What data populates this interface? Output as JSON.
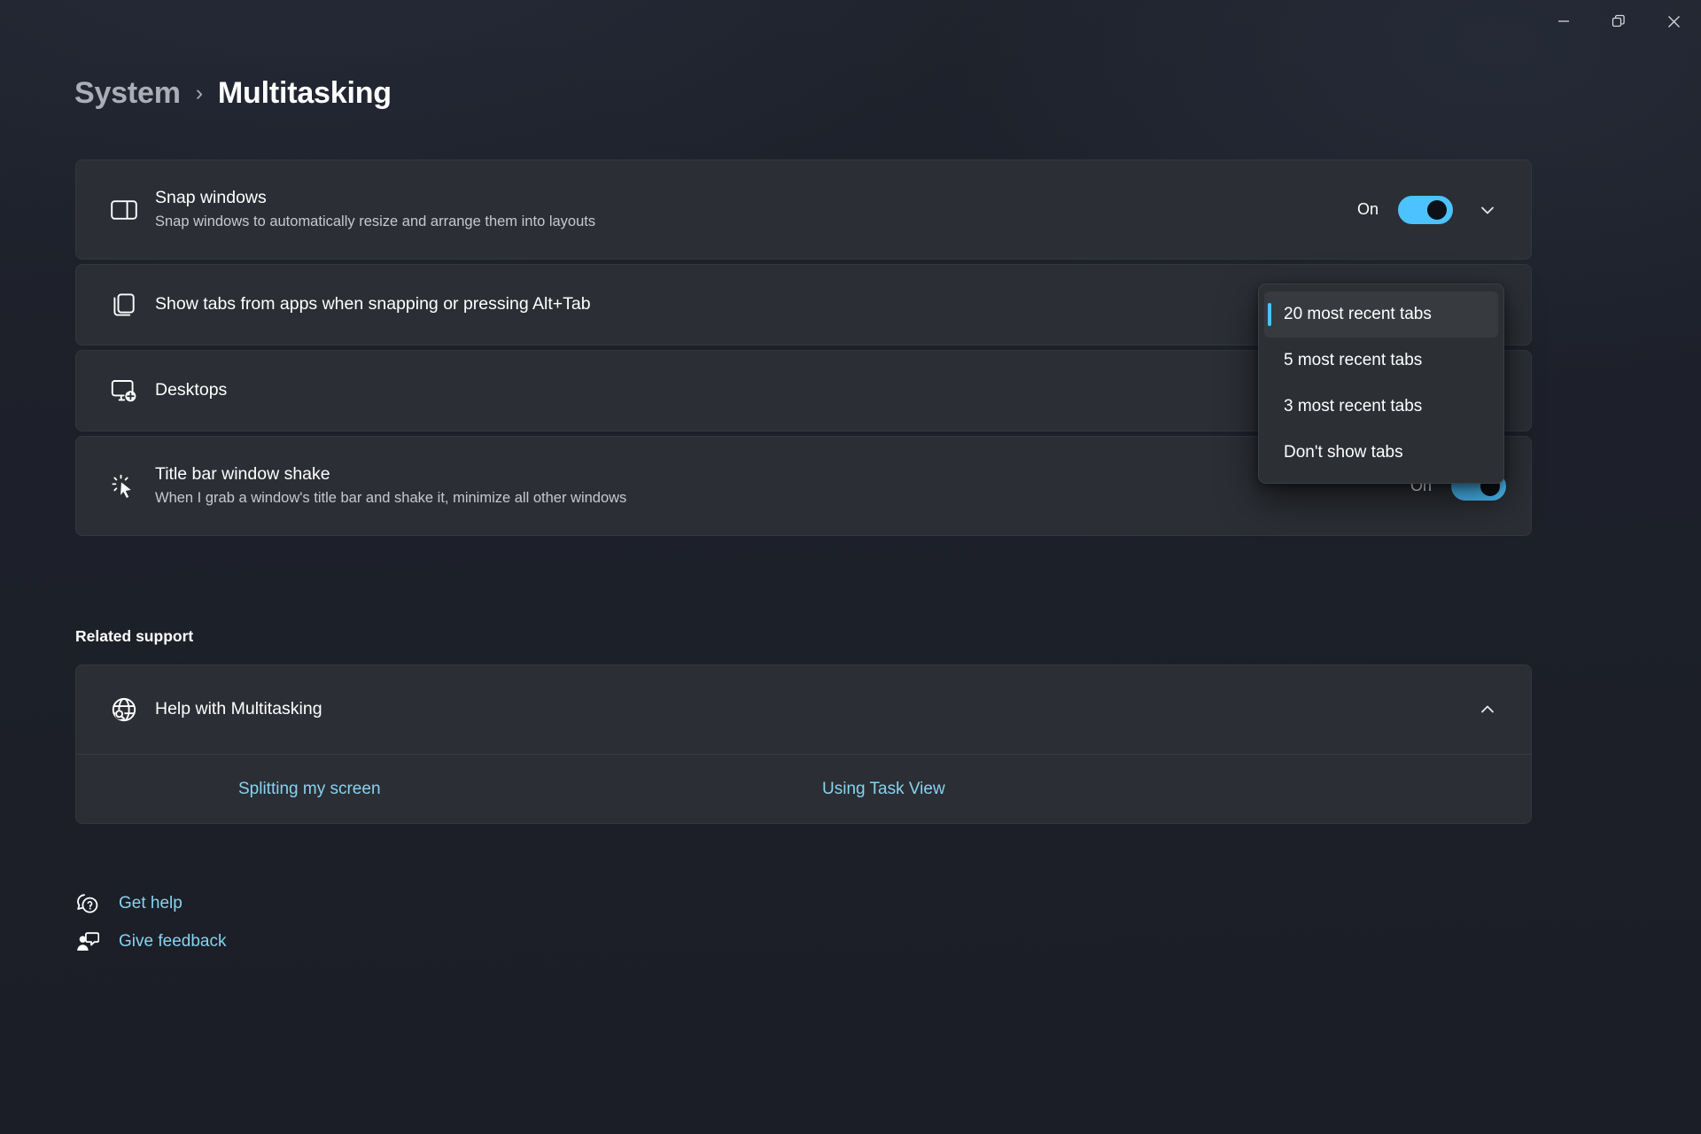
{
  "window": {
    "controls": [
      {
        "name": "minimize-button",
        "glyph": "minimize"
      },
      {
        "name": "restore-button",
        "glyph": "restore"
      },
      {
        "name": "close-button",
        "glyph": "close"
      }
    ]
  },
  "breadcrumb": {
    "parent": "System",
    "separator": "›",
    "current": "Multitasking"
  },
  "settings": [
    {
      "icon": "snap-layout-icon",
      "title": "Snap windows",
      "subtitle": "Snap windows to automatically resize and arrange them into layouts",
      "state_label": "On",
      "toggle": true,
      "expander": "chevron-down-icon"
    },
    {
      "icon": "stacked-windows-icon",
      "title": "Show tabs from apps when snapping or pressing Alt+Tab",
      "subtitle": "",
      "value": "20 most recent tabs"
    },
    {
      "icon": "desktop-add-icon",
      "title": "Desktops",
      "subtitle": "",
      "expander": "chevron-down-icon"
    },
    {
      "icon": "window-shake-icon",
      "title": "Title bar window shake",
      "subtitle": "When I grab a window's title bar and shake it, minimize all other windows",
      "state_label": "On",
      "toggle": true
    }
  ],
  "tabs_flyout": {
    "options": [
      "20 most recent tabs",
      "5 most recent tabs",
      "3 most recent tabs",
      "Don't show tabs"
    ],
    "selected_index": 0
  },
  "related_support": {
    "heading": "Related support",
    "help_icon": "globe-search-icon",
    "help_title": "Help with Multitasking",
    "collapse_icon": "chevron-up-icon",
    "links": [
      "Splitting my screen",
      "Using Task View"
    ]
  },
  "bottom_links": [
    {
      "icon": "get-help-icon",
      "label": "Get help"
    },
    {
      "icon": "feedback-icon",
      "label": "Give feedback"
    }
  ],
  "colors": {
    "accent": "#4cc2ff",
    "link": "#88d3f0",
    "card": "#2b2e34",
    "background": "#1b1e26"
  }
}
